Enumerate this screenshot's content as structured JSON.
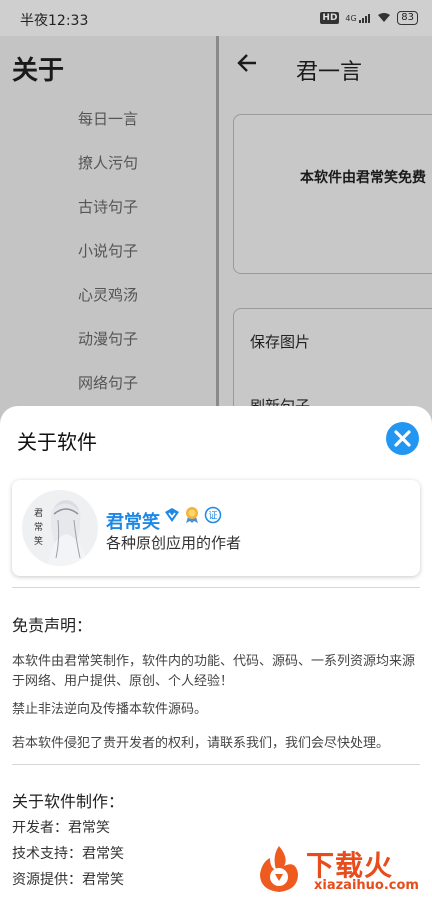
{
  "status_bar": {
    "time": "半夜12:33",
    "network_badge": "HD",
    "signal": "4G",
    "battery": "83"
  },
  "drawer": {
    "title": "关于",
    "items": [
      "每日一言",
      "撩人污句",
      "古诗句子",
      "小说句子",
      "心灵鸡汤",
      "动漫句子",
      "网络句子"
    ]
  },
  "main": {
    "title": "君一言",
    "card_text": "本软件由君常笑免费",
    "actions": [
      "保存图片",
      "刷新句子"
    ]
  },
  "sheet": {
    "title": "关于软件",
    "close_icon": "close-icon",
    "author": {
      "name": "君常笑",
      "description": "各种原创应用的作者",
      "badges": [
        "verified-v-icon",
        "medal-icon",
        "certified-icon"
      ],
      "cert_label": "证"
    },
    "disclaimer": {
      "title": "免责声明：",
      "paragraphs": [
        "本软件由君常笑制作，软件内的功能、代码、源码、一系列资源均来源于网络、用户提供、原创、个人经验！",
        "禁止非法逆向及传播本软件源码。",
        "若本软件侵犯了贵开发者的权利，请联系我们，我们会尽快处理。"
      ]
    },
    "credits": {
      "title": "关于软件制作：",
      "rows": [
        "开发者：君常笑",
        "技术支持：君常笑",
        "资源提供：君常笑"
      ]
    }
  },
  "watermark": {
    "text": "下载火",
    "url": "xiazaihuo.com"
  },
  "colors": {
    "accent": "#2196f3",
    "author_name": "#1e88e5",
    "watermark": "#e74c1a"
  }
}
